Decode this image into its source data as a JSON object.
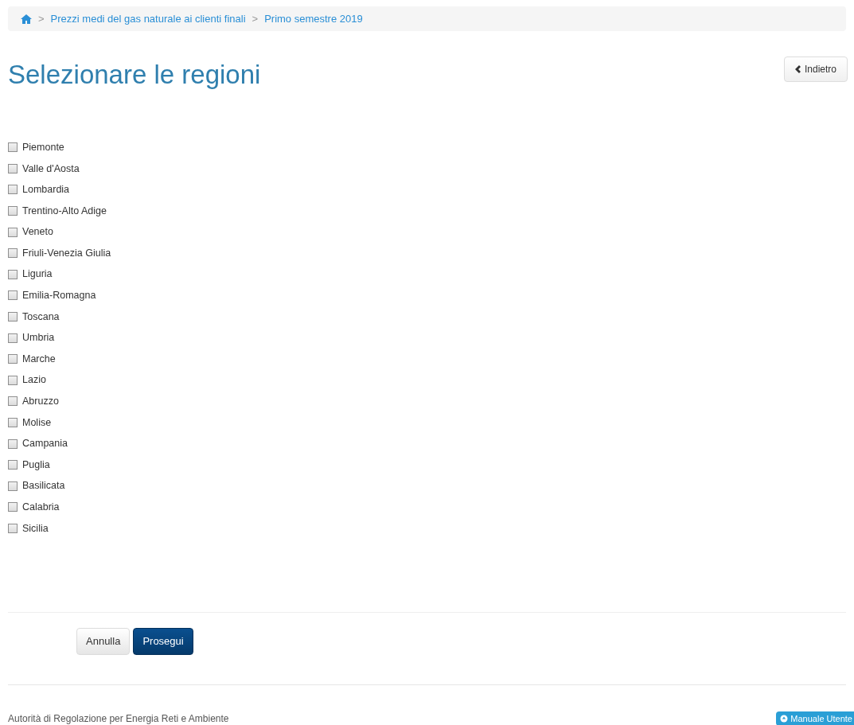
{
  "breadcrumb": {
    "items": [
      {
        "label": "Prezzi medi del gas naturale ai clienti finali"
      },
      {
        "label": "Primo semestre 2019"
      }
    ],
    "separator": ">"
  },
  "title": "Selezionare le regioni",
  "back_button": "Indietro",
  "regions": [
    {
      "label": "Piemonte",
      "checked": false
    },
    {
      "label": "Valle d'Aosta",
      "checked": false
    },
    {
      "label": "Lombardia",
      "checked": false
    },
    {
      "label": "Trentino-Alto Adige",
      "checked": false
    },
    {
      "label": "Veneto",
      "checked": false
    },
    {
      "label": "Friuli-Venezia Giulia",
      "checked": false
    },
    {
      "label": "Liguria",
      "checked": false
    },
    {
      "label": "Emilia-Romagna",
      "checked": false
    },
    {
      "label": "Toscana",
      "checked": false
    },
    {
      "label": "Umbria",
      "checked": false
    },
    {
      "label": "Marche",
      "checked": false
    },
    {
      "label": "Lazio",
      "checked": false
    },
    {
      "label": "Abruzzo",
      "checked": false
    },
    {
      "label": "Molise",
      "checked": false
    },
    {
      "label": "Campania",
      "checked": false
    },
    {
      "label": "Puglia",
      "checked": false
    },
    {
      "label": "Basilicata",
      "checked": false
    },
    {
      "label": "Calabria",
      "checked": false
    },
    {
      "label": "Sicilia",
      "checked": false
    }
  ],
  "buttons": [
    {
      "label": "Annulla",
      "kind": "default"
    },
    {
      "label": "Prosegui",
      "kind": "primary"
    }
  ],
  "footer": {
    "text": "Autorità di Regolazione per Energia Reti e Ambiente",
    "manual_button": "Manuale Utente"
  }
}
